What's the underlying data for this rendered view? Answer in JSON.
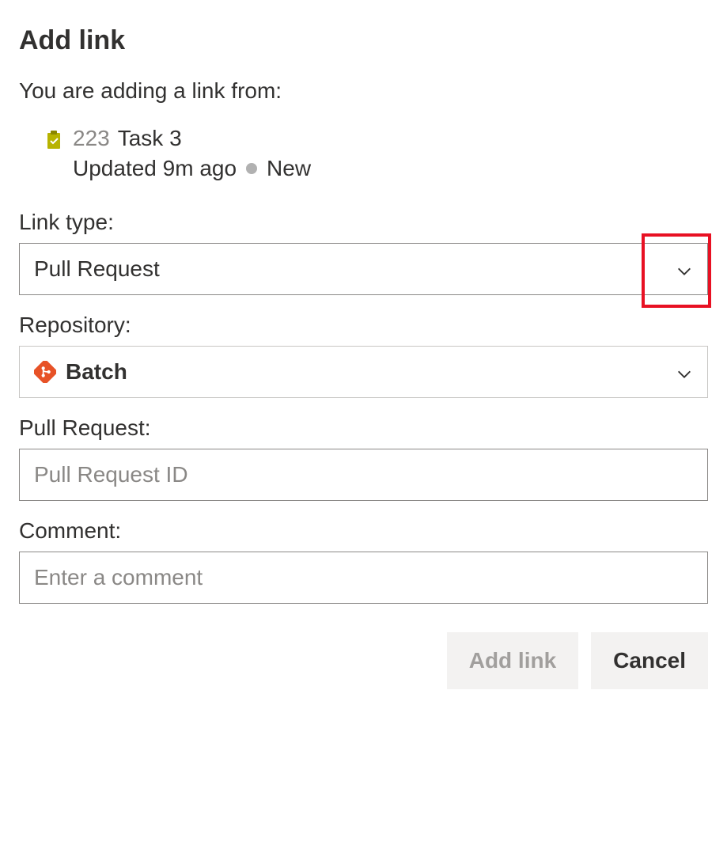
{
  "dialog": {
    "title": "Add link",
    "subtitle": "You are adding a link from:"
  },
  "work_item": {
    "id": "223",
    "title": "Task 3",
    "updated": "Updated 9m ago",
    "state": "New",
    "icon": "task-clipboard-icon",
    "icon_color": "#b7b300"
  },
  "fields": {
    "link_type": {
      "label": "Link type:",
      "value": "Pull Request"
    },
    "repository": {
      "label": "Repository:",
      "value": "Batch",
      "icon": "git-repo-icon",
      "icon_color": "#e75227"
    },
    "pull_request": {
      "label": "Pull Request:",
      "placeholder": "Pull Request ID",
      "value": ""
    },
    "comment": {
      "label": "Comment:",
      "placeholder": "Enter a comment",
      "value": ""
    }
  },
  "buttons": {
    "add_link": "Add link",
    "cancel": "Cancel"
  },
  "highlight": {
    "color": "#e81123"
  }
}
